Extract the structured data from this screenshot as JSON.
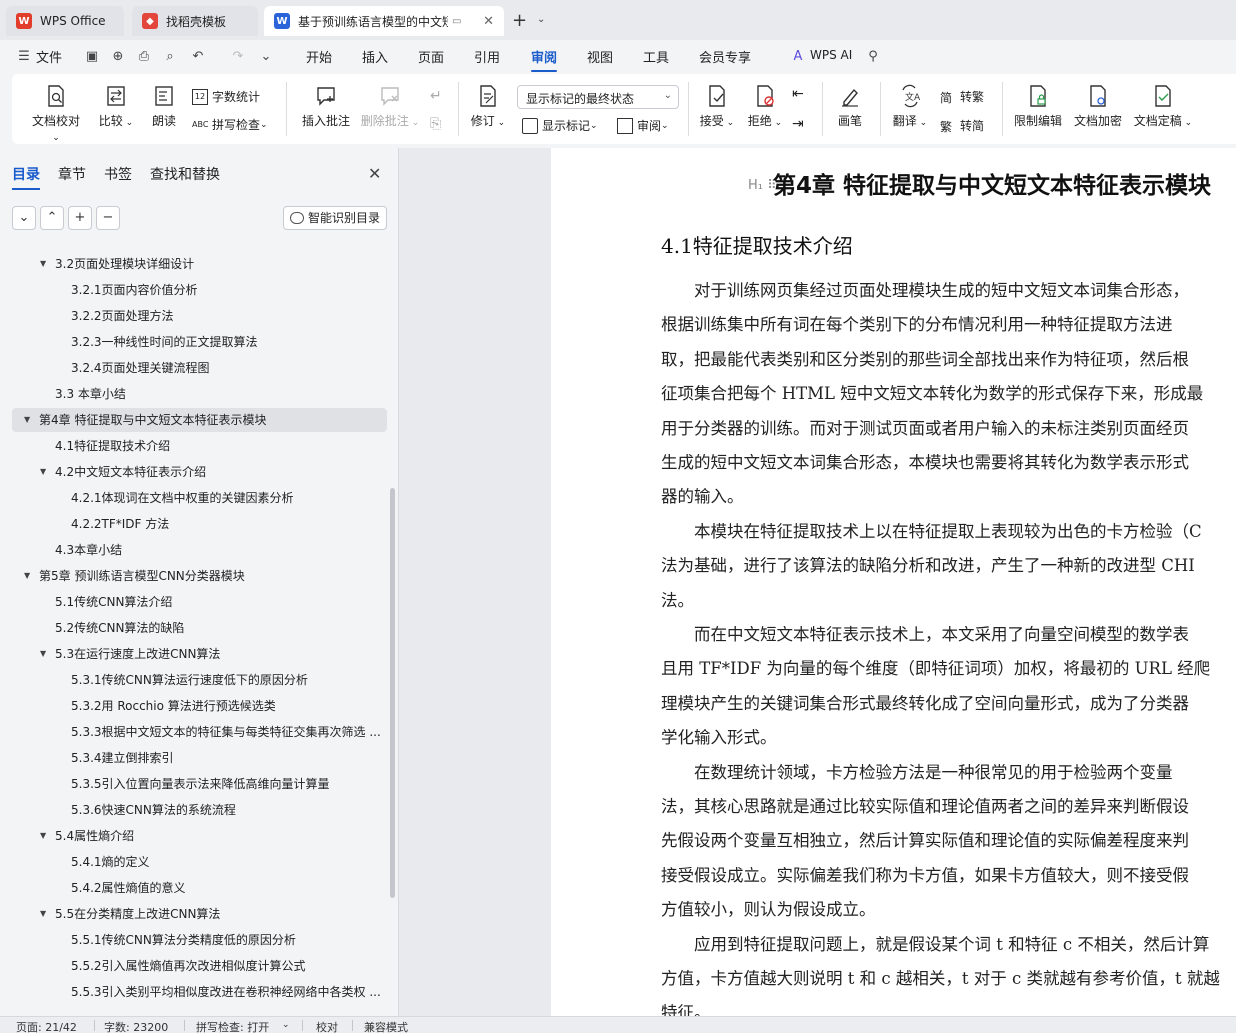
{
  "tabs": [
    {
      "label": "WPS Office",
      "icon": "wps-logo-icon",
      "color": "#e23c2b"
    },
    {
      "label": "找稻壳模板",
      "icon": "docer-icon",
      "color": "#e2463d"
    },
    {
      "label": "基于预训练语言模型的中文短文",
      "icon": "word-doc-icon",
      "color": "#2b63d9"
    }
  ],
  "menu": {
    "file": "文件",
    "items": [
      "开始",
      "插入",
      "页面",
      "引用",
      "审阅",
      "视图",
      "工具",
      "会员专享"
    ],
    "active": "审阅",
    "ai": "WPS AI"
  },
  "ribbon": {
    "proofread": "文档校对",
    "compare": "比较",
    "read_aloud": "朗读",
    "word_count": "字数统计",
    "spell_check": "拼写检查",
    "insert_comment": "插入批注",
    "delete_comment": "删除批注",
    "revise": "修订",
    "mark_mode": "显示标记的最终状态",
    "show_marks": "显示标记",
    "review": "审阅",
    "accept": "接受",
    "reject": "拒绝",
    "pen": "画笔",
    "translate": "翻译",
    "to_traditional": "转繁",
    "to_simplified": "转简",
    "restrict_edit": "限制编辑",
    "encrypt": "文档加密",
    "finalize": "文档定稿"
  },
  "nav": {
    "tabs": [
      "目录",
      "章节",
      "书签",
      "查找和替换"
    ],
    "active_tab": "目录",
    "smart_toc": "智能识别目录",
    "toc": [
      {
        "level": 2,
        "text": "3.2页面处理模块详细设计",
        "arrow": true
      },
      {
        "level": 3,
        "text": "3.2.1页面内容价值分析",
        "arrow": false
      },
      {
        "level": 3,
        "text": "3.2.2页面处理方法",
        "arrow": false
      },
      {
        "level": 3,
        "text": "3.2.3一种线性时间的正文提取算法",
        "arrow": false
      },
      {
        "level": 3,
        "text": "3.2.4页面处理关键流程图",
        "arrow": false
      },
      {
        "level": 2,
        "text": "3.3 本章小结",
        "arrow": false
      },
      {
        "level": 1,
        "text": "第4章 特征提取与中文短文本特征表示模块",
        "arrow": true,
        "selected": true
      },
      {
        "level": 2,
        "text": "4.1特征提取技术介绍",
        "arrow": false
      },
      {
        "level": 2,
        "text": "4.2中文短文本特征表示介绍",
        "arrow": true
      },
      {
        "level": 3,
        "text": "4.2.1体现词在文档中权重的关键因素分析",
        "arrow": false
      },
      {
        "level": 3,
        "text": "4.2.2TF*IDF 方法",
        "arrow": false
      },
      {
        "level": 2,
        "text": "4.3本章小结",
        "arrow": false
      },
      {
        "level": 1,
        "text": "第5章 预训练语言模型CNN分类器模块",
        "arrow": true
      },
      {
        "level": 2,
        "text": "5.1传统CNN算法介绍",
        "arrow": false
      },
      {
        "level": 2,
        "text": "5.2传统CNN算法的缺陷",
        "arrow": false
      },
      {
        "level": 2,
        "text": "5.3在运行速度上改进CNN算法",
        "arrow": true
      },
      {
        "level": 3,
        "text": "5.3.1传统CNN算法运行速度低下的原因分析",
        "arrow": false
      },
      {
        "level": 3,
        "text": "5.3.2用 Rocchio 算法进行预选候选类",
        "arrow": false
      },
      {
        "level": 3,
        "text": "5.3.3根据中文短文本的特征集与每类特征交集再次筛选 ...",
        "arrow": false
      },
      {
        "level": 3,
        "text": "5.3.4建立倒排索引",
        "arrow": false
      },
      {
        "level": 3,
        "text": "5.3.5引入位置向量表示法来降低高维向量计算量",
        "arrow": false
      },
      {
        "level": 3,
        "text": "5.3.6快速CNN算法的系统流程",
        "arrow": false
      },
      {
        "level": 2,
        "text": "5.4属性熵介绍",
        "arrow": true
      },
      {
        "level": 3,
        "text": "5.4.1熵的定义",
        "arrow": false
      },
      {
        "level": 3,
        "text": "5.4.2属性熵值的意义",
        "arrow": false
      },
      {
        "level": 2,
        "text": "5.5在分类精度上改进CNN算法",
        "arrow": true
      },
      {
        "level": 3,
        "text": "5.5.1传统CNN算法分类精度低的原因分析",
        "arrow": false
      },
      {
        "level": 3,
        "text": "5.5.2引入属性熵值再次改进相似度计算公式",
        "arrow": false
      },
      {
        "level": 3,
        "text": "5.5.3引入类别平均相似度改进在卷积神经网络中各类权 ...",
        "arrow": false
      }
    ]
  },
  "document": {
    "chapter_title": "第4章 特征提取与中文短文本特征表示模块",
    "section_title": "4.1特征提取技术介绍",
    "lines": [
      "　　对于训练网页集经过页面处理模块生成的短中文短文本词集合形态，",
      "根据训练集中所有词在每个类别下的分布情况利用一种特征提取方法进",
      "取，把最能代表类别和区分类别的那些词全部找出来作为特征项，然后根",
      "征项集合把每个 HTML 短中文短文本转化为数学的形式保存下来，形成最",
      "用于分类器的训练。而对于测试页面或者用户输入的未标注类别页面经页",
      "生成的短中文短文本词集合形态，本模块也需要将其转化为数学表示形式",
      "器的输入。",
      "　　本模块在特征提取技术上以在特征提取上表现较为出色的卡方检验（C",
      "法为基础，进行了该算法的缺陷分析和改进，产生了一种新的改进型 CHI",
      "法。",
      "　　而在中文短文本特征表示技术上，本文采用了向量空间模型的数学表",
      "且用 TF*IDF 为向量的每个维度（即特征词项）加权，将最初的 URL 经爬",
      "理模块产生的关键词集合形式最终转化成了空间向量形式，成为了分类器",
      "学化输入形式。",
      "　　在数理统计领域，卡方检验方法是一种很常见的用于检验两个变量",
      "法，其核心思路就是通过比较实际值和理论值两者之间的差异来判断假设",
      "先假设两个变量互相独立，然后计算实际值和理论值的实际偏差程度来判",
      "接受假设成立。实际偏差我们称为卡方值，如果卡方值较大，则不接受假",
      "方值较小，则认为假设成立。",
      "　　应用到特征提取问题上，就是假设某个词 t 和特征 c 不相关，然后计算",
      "方值，卡方值越大则说明 t 和 c 越相关，t 对于 c 类就越有参考价值，t 就越",
      "特征。"
    ]
  },
  "status": {
    "page": "页面: 21/42",
    "words": "字数: 23200",
    "spell": "拼写检查: 打开",
    "proof": "校对",
    "compat": "兼容模式"
  }
}
